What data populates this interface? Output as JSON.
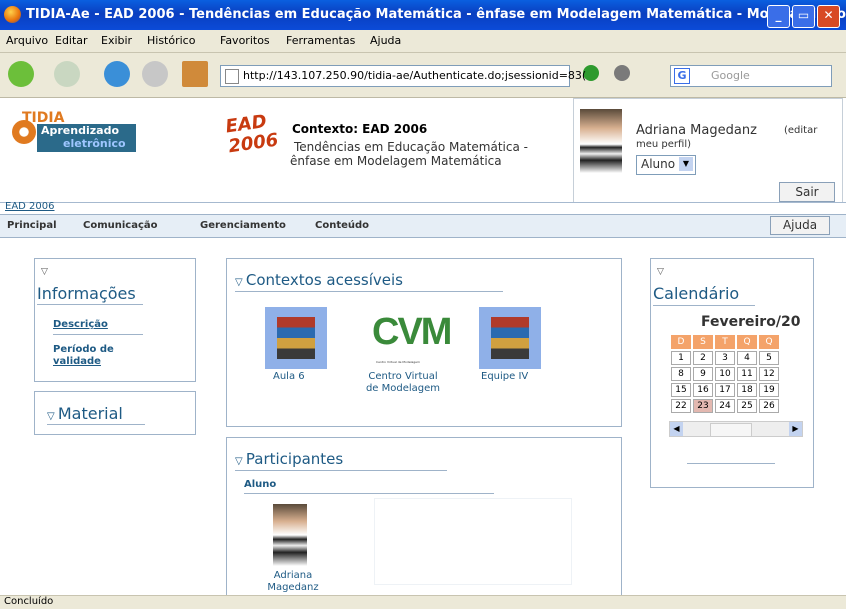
{
  "window": {
    "title": "TIDIA-Ae - EAD 2006 - Tendências em Educação Matemática - ênfase em Modelagem Matemática - Mozilla Firefox",
    "buttons": [
      "_",
      "▭",
      "✕"
    ]
  },
  "menu": [
    "Arquivo",
    "Editar",
    "Exibir",
    "Histórico",
    "Favoritos",
    "Ferramentas",
    "Ajuda"
  ],
  "toolbar": {
    "url": "http://143.107.250.90/tidia-ae/Authenticate.do;jsessionid=83(",
    "search_placeholder": "Google",
    "search_engine": "G"
  },
  "header": {
    "logo_top": "TIDIA",
    "logo_line1": "Aprendizado",
    "logo_line2": "eletrônico",
    "ead_logo_line1": "EAD",
    "ead_logo_line2": "2006",
    "context_label": "Contexto: EAD 2006",
    "context_desc_line1": "Tendências em Educação Matemática -",
    "context_desc_line2": "ênfase em Modelagem Matemática",
    "user_name": "Adriana Magedanz",
    "edit_profile_1": "(editar",
    "edit_profile_2": "meu perfil)",
    "role_value": "Aluno",
    "logout": "Sair"
  },
  "breadcrumb": "EAD 2006",
  "tabs": [
    "Principal",
    "Comunicação",
    "Gerenciamento",
    "Conteúdo"
  ],
  "help": "Ajuda",
  "left": {
    "info_title": "Informações",
    "info_links": [
      "Descrição",
      "Período de",
      "validade"
    ],
    "material_title": "Material"
  },
  "contexts": {
    "title": "Contextos acessíveis",
    "items": [
      {
        "label1": "Aula 6",
        "label2": ""
      },
      {
        "label1": "Centro Virtual",
        "label2": "de Modelagem",
        "logo": "CVM",
        "logo_sub": "Centro Virtual de Modelagem"
      },
      {
        "label1": "Equipe IV",
        "label2": ""
      }
    ]
  },
  "participants": {
    "title": "Participantes",
    "group": "Aluno",
    "person_line1": "Adriana",
    "person_line2": "Magedanz"
  },
  "calendar": {
    "title": "Calendário",
    "month": "Fevereiro/20",
    "days": [
      "D",
      "S",
      "T",
      "Q",
      "Q"
    ],
    "rows": [
      [
        "1",
        "2",
        "3",
        "4",
        "5"
      ],
      [
        "8",
        "9",
        "10",
        "11",
        "12"
      ],
      [
        "15",
        "16",
        "17",
        "18",
        "19"
      ],
      [
        "22",
        "23",
        "24",
        "25",
        "26"
      ]
    ],
    "today": "23",
    "colors": {
      "header": "#f4a36a",
      "today": "#e3b8b0"
    }
  },
  "status": "Concluído"
}
